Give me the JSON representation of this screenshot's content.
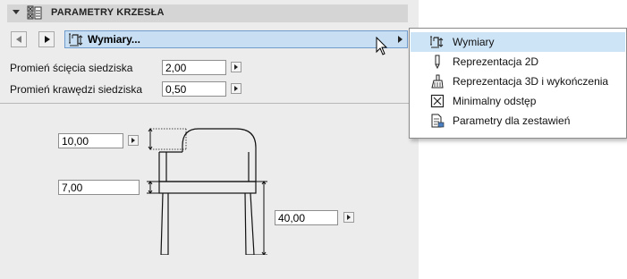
{
  "panel": {
    "title": "PARAMETRY KRZESŁA",
    "tab_label": "Wymiary...",
    "icons": {
      "collapse": "triangle-down-icon",
      "header": "chair-settings-icon",
      "back": "arrow-left-icon",
      "forward": "arrow-right-icon",
      "tab": "dimensions-icon"
    },
    "fields": [
      {
        "label": "Promień ścięcia siedziska",
        "value": "2,00"
      },
      {
        "label": "Promień krawędzi siedziska",
        "value": "0,50"
      }
    ]
  },
  "diagram": {
    "dim_back_height": "10,00",
    "dim_seat_thickness": "7,00",
    "dim_seat_height": "40,00"
  },
  "dropdown": {
    "items": [
      {
        "label": "Wymiary",
        "icon": "dimensions-icon",
        "selected": true
      },
      {
        "label": "Reprezentacja 2D",
        "icon": "pencil-icon",
        "selected": false
      },
      {
        "label": "Reprezentacja 3D i wykończenia",
        "icon": "paintbrush-icon",
        "selected": false
      },
      {
        "label": "Minimalny odstęp",
        "icon": "clearance-icon",
        "selected": false
      },
      {
        "label": "Parametry dla zestawień",
        "icon": "schedule-icon",
        "selected": false
      }
    ]
  },
  "colors": {
    "panel_bg": "#ececec",
    "header_bg": "#d5d5d5",
    "selection_bg": "#c7def3",
    "selection_border": "#6f9bcd",
    "menu_highlight": "#cde4f7"
  }
}
